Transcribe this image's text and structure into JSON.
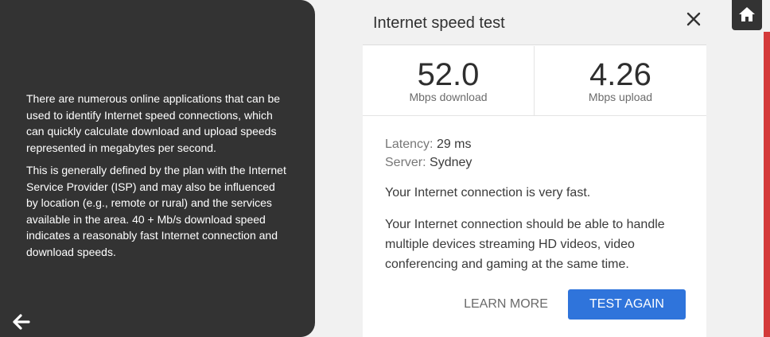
{
  "info_panel": {
    "paragraphs": [
      "There are numerous online applications that can be used to identify Internet speed connections, which can quickly calculate download and upload speeds represented in megabytes per second.",
      "This is generally defined by the plan with the Internet Service Provider (ISP) and may also be influenced by location (e.g., remote or rural) and the services available in the area. 40 + Mb/s download speed indicates a reasonably fast Internet connection and download speeds."
    ],
    "back_icon": "arrow-left-icon"
  },
  "speed_test": {
    "title": "Internet speed test",
    "close_icon": "close-icon",
    "download": {
      "value": "52.0",
      "label": "Mbps download"
    },
    "upload": {
      "value": "4.26",
      "label": "Mbps upload"
    },
    "latency": {
      "key": "Latency:",
      "value": "29 ms"
    },
    "server": {
      "key": "Server:",
      "value": "Sydney"
    },
    "verdict": "Your Internet connection is very fast.",
    "description": "Your Internet connection should be able to handle multiple devices streaming HD videos, video conferencing and gaming at the same time.",
    "learn_more_label": "LEARN MORE",
    "test_again_label": "TEST AGAIN"
  },
  "home": {
    "icon": "home-icon"
  },
  "colors": {
    "panel_bg": "#333333",
    "primary_button": "#2f74db",
    "accent": "#d43a3a"
  }
}
